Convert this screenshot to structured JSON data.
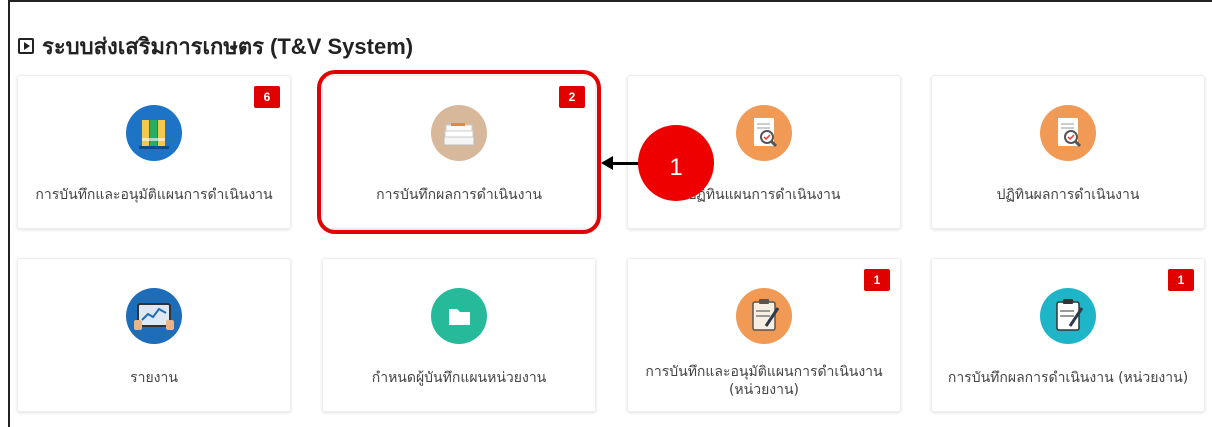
{
  "header": {
    "title": "ระบบส่งเสริมการเกษตร (T&V System)"
  },
  "cards": [
    {
      "label": "การบันทึกและอนุมัติแผนการดำเนินงาน",
      "badge": "6",
      "icon": "binders-icon",
      "icon_color": "#1d74c7"
    },
    {
      "label": "การบันทึกผลการดำเนินงาน",
      "badge": "2",
      "icon": "paper-stack-icon",
      "icon_color": "#d8b89a"
    },
    {
      "label": "ปฏิทินแผนการดำเนินงาน",
      "badge": "",
      "icon": "document-search-icon",
      "icon_color": "#f09a55"
    },
    {
      "label": "ปฏิทินผลการดำเนินงาน",
      "badge": "",
      "icon": "document-search-icon",
      "icon_color": "#f09a55"
    },
    {
      "label": "รายงาน",
      "badge": "",
      "icon": "tablet-report-icon",
      "icon_color": "#1d6db8"
    },
    {
      "label": "กำหนดผู้บันทึกแผนหน่วยงาน",
      "badge": "",
      "icon": "folder-icon",
      "icon_color": "#26b99a"
    },
    {
      "label": "การบันทึกและอนุมัติแผนการดำเนินงาน (หน่วยงาน)",
      "badge": "1",
      "icon": "clipboard-pen-icon",
      "icon_color": "#f09a55"
    },
    {
      "label": "การบันทึกผลการดำเนินงาน (หน่วยงาน)",
      "badge": "1",
      "icon": "clipboard-pen-icon",
      "icon_color": "#1fb5c9"
    }
  ],
  "annotation": {
    "callout_number": "1",
    "highlight_color": "#e30000"
  }
}
